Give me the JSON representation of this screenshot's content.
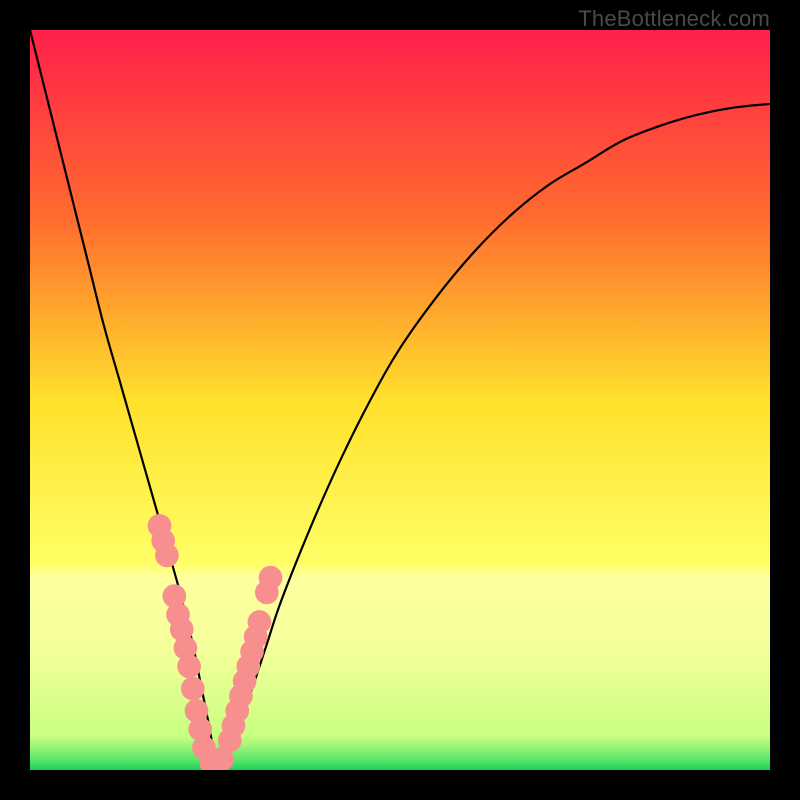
{
  "watermark": "TheBottleneck.com",
  "chart_data": {
    "type": "line",
    "title": "",
    "xlabel": "",
    "ylabel": "",
    "xlim": [
      0,
      100
    ],
    "ylim": [
      0,
      100
    ],
    "grid": false,
    "legend": false,
    "gradient_stops": [
      {
        "offset": 0.0,
        "color": "#ff1f4b"
      },
      {
        "offset": 0.25,
        "color": "#ff6a2f"
      },
      {
        "offset": 0.5,
        "color": "#ffe02b"
      },
      {
        "offset": 0.72,
        "color": "#ffff66"
      },
      {
        "offset": 0.74,
        "color": "#ffffa0"
      },
      {
        "offset": 0.84,
        "color": "#f4ff9a"
      },
      {
        "offset": 0.955,
        "color": "#c8ff80"
      },
      {
        "offset": 0.985,
        "color": "#5ee86b"
      },
      {
        "offset": 1.0,
        "color": "#1fcf57"
      }
    ],
    "curve": {
      "x": [
        0,
        2,
        4,
        6,
        8,
        10,
        12,
        14,
        16,
        18,
        20,
        21,
        22,
        23,
        24,
        25,
        26,
        27,
        28,
        30,
        32,
        34,
        38,
        42,
        46,
        50,
        55,
        60,
        65,
        70,
        75,
        80,
        85,
        90,
        95,
        100
      ],
      "y": [
        100,
        92,
        84,
        76,
        68,
        60,
        53,
        46,
        39,
        32,
        25,
        21,
        17,
        12,
        7,
        2,
        1,
        3,
        6,
        11,
        17,
        23,
        33,
        42,
        50,
        57,
        64,
        70,
        75,
        79,
        82,
        85,
        87,
        88.5,
        89.5,
        90
      ]
    },
    "markers": {
      "color": "#f88f8f",
      "radius": 1.6,
      "x": [
        17.5,
        18.0,
        18.5,
        19.5,
        20.0,
        20.5,
        21.0,
        21.5,
        22.0,
        22.5,
        23.0,
        23.5,
        24.5,
        25.0,
        25.5,
        26.0,
        27.0,
        27.5,
        28.0,
        28.5,
        29.0,
        29.5,
        30.0,
        30.5,
        31.0,
        32.0,
        32.5
      ],
      "y": [
        33.0,
        31.0,
        29.0,
        23.5,
        21.0,
        19.0,
        16.5,
        14.0,
        11.0,
        8.0,
        5.5,
        3.0,
        1.0,
        1.0,
        1.0,
        1.5,
        4.0,
        6.0,
        8.0,
        10.0,
        12.0,
        14.0,
        16.0,
        18.0,
        20.0,
        24.0,
        26.0
      ]
    }
  }
}
